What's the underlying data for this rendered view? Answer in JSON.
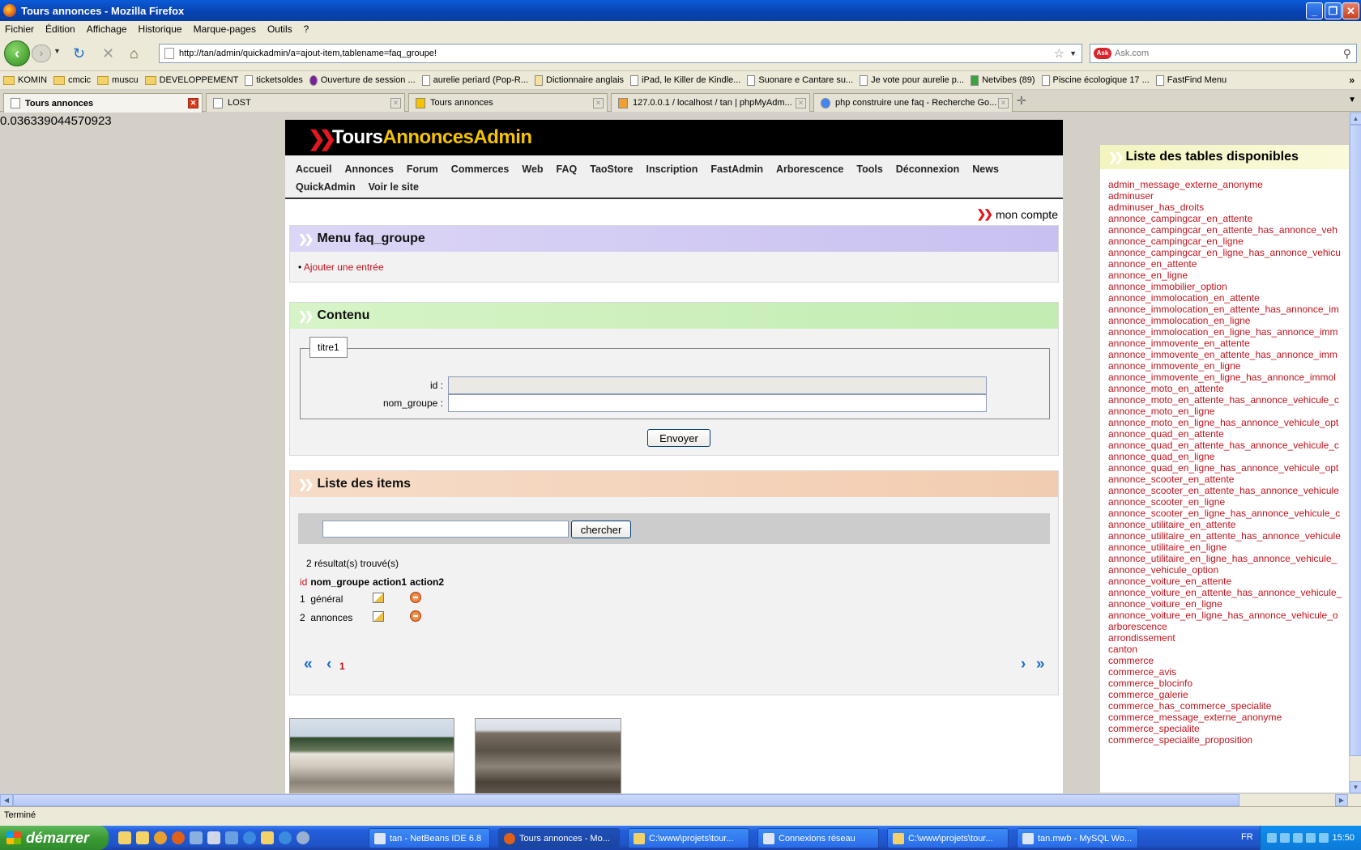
{
  "window": {
    "title": "Tours annonces - Mozilla Firefox"
  },
  "menubar": [
    "Fichier",
    "Édition",
    "Affichage",
    "Historique",
    "Marque-pages",
    "Outils",
    "?"
  ],
  "navbar": {
    "url": "http://tan/admin/quickadmin/a=ajout-item,tablename=faq_groupe!",
    "search_placeholder": "Ask.com"
  },
  "bookmarks": [
    {
      "label": "KOMIN",
      "type": "folder"
    },
    {
      "label": "cmcic",
      "type": "folder"
    },
    {
      "label": "muscu",
      "type": "folder"
    },
    {
      "label": "DEVELOPPEMENT",
      "type": "folder"
    },
    {
      "label": "ticketsoldes",
      "type": "page"
    },
    {
      "label": "Ouverture de session ...",
      "type": "page"
    },
    {
      "label": "aurelie periard (Pop-R...",
      "type": "page"
    },
    {
      "label": "Dictionnaire anglais",
      "type": "page"
    },
    {
      "label": "iPad, le Killer de Kindle...",
      "type": "page"
    },
    {
      "label": "Suonare e Cantare su...",
      "type": "page"
    },
    {
      "label": "Je vote pour aurelie p...",
      "type": "page"
    },
    {
      "label": "Netvibes (89)",
      "type": "page"
    },
    {
      "label": "Piscine écologique 17 ...",
      "type": "page"
    },
    {
      "label": "FastFind Menu",
      "type": "page"
    }
  ],
  "tabs": [
    {
      "label": "Tours annonces",
      "active": true
    },
    {
      "label": "LOST",
      "active": false
    },
    {
      "label": "Tours annonces",
      "active": false
    },
    {
      "label": "127.0.0.1 / localhost / tan | phpMyAdm...",
      "active": false
    },
    {
      "label": "php construire une faq - Recherche Go...",
      "active": false
    }
  ],
  "page": {
    "random_number": "0.036339044570923",
    "logo": {
      "part1": "Tours",
      "part2": "AnnoncesAdmin"
    },
    "nav": [
      "Accueil",
      "Annonces",
      "Forum",
      "Commerces",
      "Web",
      "FAQ",
      "TaoStore",
      "Inscription",
      "FastAdmin",
      "Arborescence",
      "Tools",
      "Déconnexion",
      "News",
      "QuickAdmin",
      "Voir le site"
    ],
    "mon_compte": "mon compte",
    "menu_box": {
      "title": "Menu faq_groupe",
      "action": "Ajouter une entrée"
    },
    "content_box": {
      "title": "Contenu",
      "legend": "titre1",
      "id_label": "id :",
      "id_value": "",
      "nom_label": "nom_groupe :",
      "nom_value": "",
      "submit": "Envoyer"
    },
    "items_box": {
      "title": "Liste des items",
      "search_value": "",
      "search_button": "chercher",
      "results": "2 résultat(s) trouvé(s)",
      "columns": [
        "id",
        "nom_groupe",
        "action1",
        "action2"
      ],
      "rows": [
        {
          "id": "1",
          "nom_groupe": "général"
        },
        {
          "id": "2",
          "nom_groupe": "annonces"
        }
      ],
      "current_page": "1"
    }
  },
  "sidebar": {
    "title": "Liste des tables disponibles",
    "tables": [
      "admin_message_externe_anonyme",
      "adminuser",
      "adminuser_has_droits",
      "annonce_campingcar_en_attente",
      "annonce_campingcar_en_attente_has_annonce_veh",
      "annonce_campingcar_en_ligne",
      "annonce_campingcar_en_ligne_has_annonce_vehicu",
      "annonce_en_attente",
      "annonce_en_ligne",
      "annonce_immobilier_option",
      "annonce_immolocation_en_attente",
      "annonce_immolocation_en_attente_has_annonce_im",
      "annonce_immolocation_en_ligne",
      "annonce_immolocation_en_ligne_has_annonce_imm",
      "annonce_immovente_en_attente",
      "annonce_immovente_en_attente_has_annonce_imm",
      "annonce_immovente_en_ligne",
      "annonce_immovente_en_ligne_has_annonce_immol",
      "annonce_moto_en_attente",
      "annonce_moto_en_attente_has_annonce_vehicule_c",
      "annonce_moto_en_ligne",
      "annonce_moto_en_ligne_has_annonce_vehicule_opt",
      "annonce_quad_en_attente",
      "annonce_quad_en_attente_has_annonce_vehicule_c",
      "annonce_quad_en_ligne",
      "annonce_quad_en_ligne_has_annonce_vehicule_opt",
      "annonce_scooter_en_attente",
      "annonce_scooter_en_attente_has_annonce_vehicule",
      "annonce_scooter_en_ligne",
      "annonce_scooter_en_ligne_has_annonce_vehicule_c",
      "annonce_utilitaire_en_attente",
      "annonce_utilitaire_en_attente_has_annonce_vehicule",
      "annonce_utilitaire_en_ligne",
      "annonce_utilitaire_en_ligne_has_annonce_vehicule_",
      "annonce_vehicule_option",
      "annonce_voiture_en_attente",
      "annonce_voiture_en_attente_has_annonce_vehicule_",
      "annonce_voiture_en_ligne",
      "annonce_voiture_en_ligne_has_annonce_vehicule_o",
      "arborescence",
      "arrondissement",
      "canton",
      "commerce",
      "commerce_avis",
      "commerce_blocinfo",
      "commerce_galerie",
      "commerce_has_commerce_specialite",
      "commerce_message_externe_anonyme",
      "commerce_specialite",
      "commerce_specialite_proposition"
    ]
  },
  "status": "Terminé",
  "taskbar": {
    "start": "démarrer",
    "tasks": [
      {
        "label": "tan - NetBeans IDE 6.8",
        "active": false
      },
      {
        "label": "Tours annonces - Mo...",
        "active": true
      },
      {
        "label": "C:\\www\\projets\\tour...",
        "active": false
      },
      {
        "label": "Connexions réseau",
        "active": false
      },
      {
        "label": "C:\\www\\projets\\tour...",
        "active": false
      },
      {
        "label": "tan.mwb - MySQL Wo...",
        "active": false
      }
    ],
    "lang": "FR",
    "clock": "15:50"
  }
}
